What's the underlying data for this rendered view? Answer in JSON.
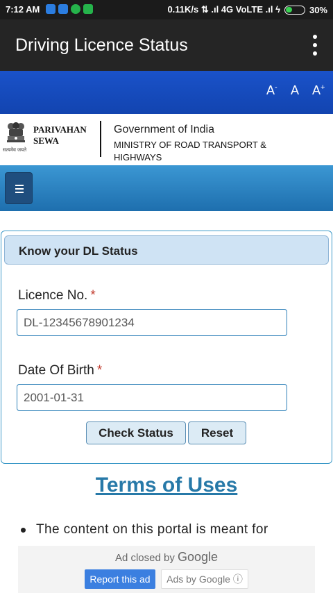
{
  "status_bar": {
    "time": "7:12 AM",
    "network": "0.11K/s ⇅ .ıl 4G VoLTE .ıl ϟ",
    "battery": "30%",
    "icon_colors": [
      "#2b7de0",
      "#2b7de0",
      "#25b34b",
      "#25b34b"
    ]
  },
  "app_bar": {
    "title": "Driving Licence Status",
    "menu_icon": "more-vert-icon"
  },
  "font_controls": {
    "decrease": "A",
    "decrease_mark": "-",
    "normal": "A",
    "increase": "A",
    "increase_mark": "+"
  },
  "header": {
    "brand_line1": "PARIVAHAN",
    "brand_line2": "SEWA",
    "emblem_caption": "सत्यमेव जयते",
    "gov": "Government of India",
    "ministry": "MINISTRY OF ROAD TRANSPORT & HIGHWAYS"
  },
  "nav": {
    "menu_icon": "hamburger-icon"
  },
  "form": {
    "title": "Know your DL Status",
    "licence_label": "Licence No.",
    "licence_value": "DL-12345678901234",
    "dob_label": "Date Of Birth",
    "dob_value": "2001-01-31",
    "required_mark": "*",
    "check_button": "Check Status",
    "reset_button": "Reset"
  },
  "terms": {
    "heading": "Terms of Uses",
    "first_bullet": "The content on this portal is meant for"
  },
  "ad": {
    "closed_text": "Ad closed by",
    "google": "Google",
    "report": "Report this ad",
    "ads_by": "Ads by Google ⓘ"
  },
  "colors": {
    "app_bar": "#252525",
    "font_bar": "#1a52c9",
    "nav_bar": "#2a82c2",
    "accent": "#2779a8"
  }
}
